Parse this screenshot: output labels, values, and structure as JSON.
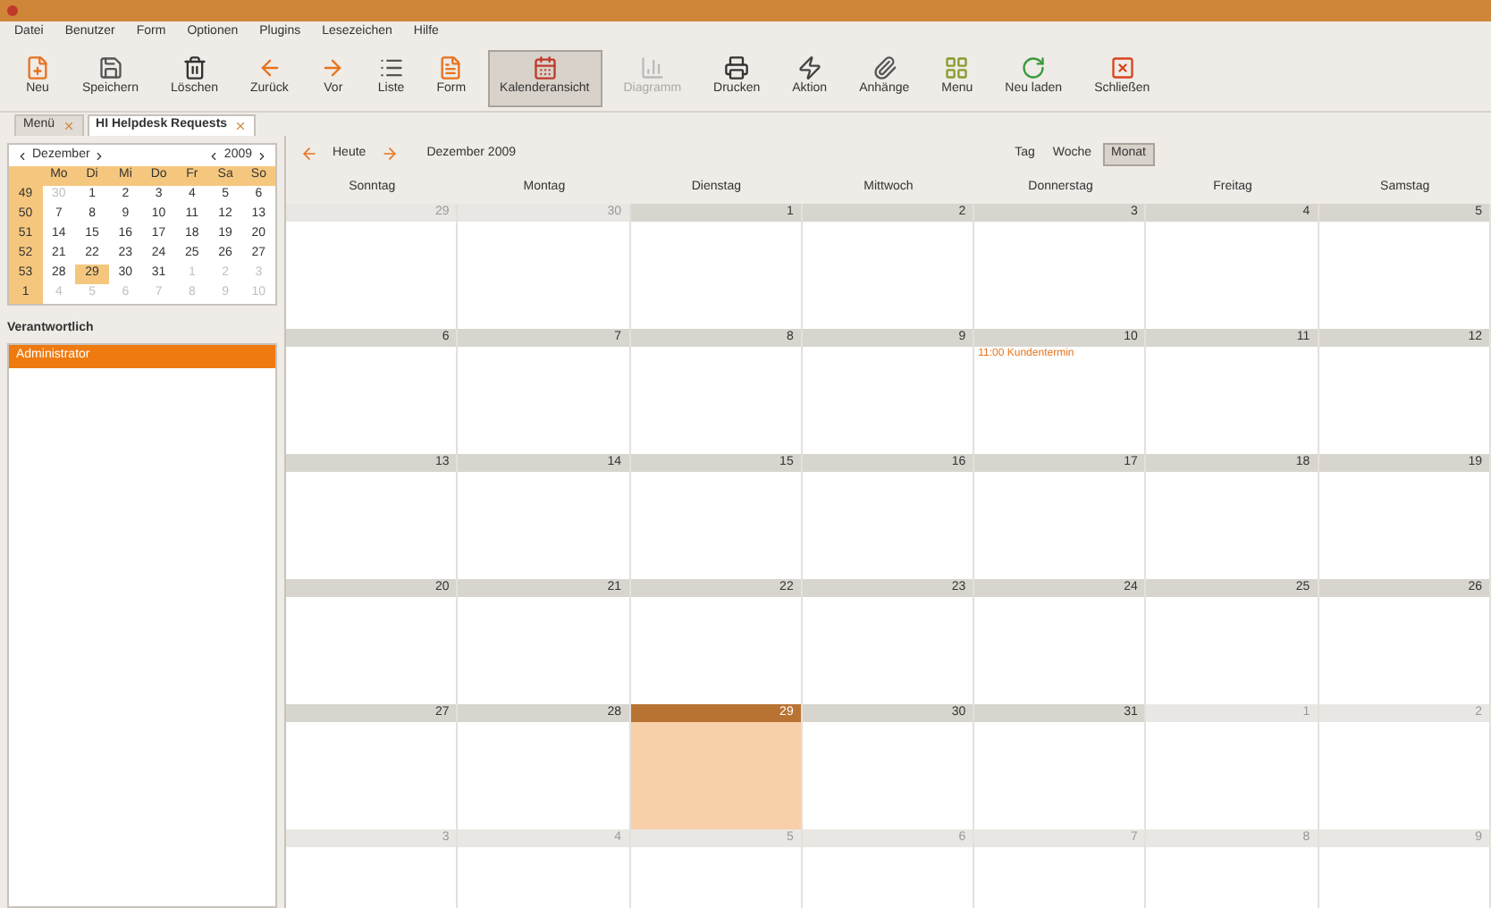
{
  "menu": [
    "Datei",
    "Benutzer",
    "Form",
    "Optionen",
    "Plugins",
    "Lesezeichen",
    "Hilfe"
  ],
  "toolbar": [
    {
      "kind": "new",
      "label": "Neu",
      "selected": false,
      "disabled": false
    },
    {
      "kind": "save",
      "label": "Speichern",
      "selected": false,
      "disabled": false
    },
    {
      "kind": "delete",
      "label": "Löschen",
      "selected": false,
      "disabled": false
    },
    {
      "kind": "back",
      "label": "Zurück",
      "selected": false,
      "disabled": false
    },
    {
      "kind": "forward",
      "label": "Vor",
      "selected": false,
      "disabled": false
    },
    {
      "kind": "list",
      "label": "Liste",
      "selected": false,
      "disabled": false
    },
    {
      "kind": "form",
      "label": "Form",
      "selected": false,
      "disabled": false
    },
    {
      "kind": "calendar",
      "label": "Kalenderansicht",
      "selected": true,
      "disabled": false
    },
    {
      "kind": "graph",
      "label": "Diagramm",
      "selected": false,
      "disabled": true
    },
    {
      "kind": "print",
      "label": "Drucken",
      "selected": false,
      "disabled": false
    },
    {
      "kind": "action",
      "label": "Aktion",
      "selected": false,
      "disabled": false
    },
    {
      "kind": "attach",
      "label": "Anhänge",
      "selected": false,
      "disabled": false
    },
    {
      "kind": "menu",
      "label": "Menu",
      "selected": false,
      "disabled": false
    },
    {
      "kind": "reload",
      "label": "Neu laden",
      "selected": false,
      "disabled": false
    },
    {
      "kind": "close",
      "label": "Schließen",
      "selected": false,
      "disabled": false
    }
  ],
  "tabs": [
    {
      "label": "Menü",
      "selected": false
    },
    {
      "label": "HI Helpdesk Requests",
      "selected": true
    }
  ],
  "mini_calendar": {
    "month": "Dezember",
    "year": "2009",
    "weekdays": [
      "Mo",
      "Di",
      "Mi",
      "Do",
      "Fr",
      "Sa",
      "So"
    ],
    "weeks": [
      {
        "week": "49",
        "days": [
          {
            "day": "30",
            "in_month": false,
            "selected": false
          },
          {
            "day": "1",
            "in_month": true,
            "selected": false
          },
          {
            "day": "2",
            "in_month": true,
            "selected": false
          },
          {
            "day": "3",
            "in_month": true,
            "selected": false
          },
          {
            "day": "4",
            "in_month": true,
            "selected": false
          },
          {
            "day": "5",
            "in_month": true,
            "selected": false
          },
          {
            "day": "6",
            "in_month": true,
            "selected": false
          }
        ]
      },
      {
        "week": "50",
        "days": [
          {
            "day": "7",
            "in_month": true,
            "selected": false
          },
          {
            "day": "8",
            "in_month": true,
            "selected": false
          },
          {
            "day": "9",
            "in_month": true,
            "selected": false
          },
          {
            "day": "10",
            "in_month": true,
            "selected": false
          },
          {
            "day": "11",
            "in_month": true,
            "selected": false
          },
          {
            "day": "12",
            "in_month": true,
            "selected": false
          },
          {
            "day": "13",
            "in_month": true,
            "selected": false
          }
        ]
      },
      {
        "week": "51",
        "days": [
          {
            "day": "14",
            "in_month": true,
            "selected": false
          },
          {
            "day": "15",
            "in_month": true,
            "selected": false
          },
          {
            "day": "16",
            "in_month": true,
            "selected": false
          },
          {
            "day": "17",
            "in_month": true,
            "selected": false
          },
          {
            "day": "18",
            "in_month": true,
            "selected": false
          },
          {
            "day": "19",
            "in_month": true,
            "selected": false
          },
          {
            "day": "20",
            "in_month": true,
            "selected": false
          }
        ]
      },
      {
        "week": "52",
        "days": [
          {
            "day": "21",
            "in_month": true,
            "selected": false
          },
          {
            "day": "22",
            "in_month": true,
            "selected": false
          },
          {
            "day": "23",
            "in_month": true,
            "selected": false
          },
          {
            "day": "24",
            "in_month": true,
            "selected": false
          },
          {
            "day": "25",
            "in_month": true,
            "selected": false
          },
          {
            "day": "26",
            "in_month": true,
            "selected": false
          },
          {
            "day": "27",
            "in_month": true,
            "selected": false
          }
        ]
      },
      {
        "week": "53",
        "days": [
          {
            "day": "28",
            "in_month": true,
            "selected": false
          },
          {
            "day": "29",
            "in_month": true,
            "selected": true
          },
          {
            "day": "30",
            "in_month": true,
            "selected": false
          },
          {
            "day": "31",
            "in_month": true,
            "selected": false
          },
          {
            "day": "1",
            "in_month": false,
            "selected": false
          },
          {
            "day": "2",
            "in_month": false,
            "selected": false
          },
          {
            "day": "3",
            "in_month": false,
            "selected": false
          }
        ]
      },
      {
        "week": "1",
        "days": [
          {
            "day": "4",
            "in_month": false,
            "selected": false
          },
          {
            "day": "5",
            "in_month": false,
            "selected": false
          },
          {
            "day": "6",
            "in_month": false,
            "selected": false
          },
          {
            "day": "7",
            "in_month": false,
            "selected": false
          },
          {
            "day": "8",
            "in_month": false,
            "selected": false
          },
          {
            "day": "9",
            "in_month": false,
            "selected": false
          },
          {
            "day": "10",
            "in_month": false,
            "selected": false
          }
        ]
      }
    ]
  },
  "filter": {
    "heading": "Verantwortlich",
    "items": [
      {
        "label": "Administrator",
        "selected": true
      }
    ]
  },
  "navigation": {
    "today": "Heute",
    "period": "Dezember 2009"
  },
  "views": [
    {
      "label": "Tag",
      "selected": false
    },
    {
      "label": "Woche",
      "selected": false
    },
    {
      "label": "Monat",
      "selected": true
    }
  ],
  "calendar": {
    "weekdays": [
      "Sonntag",
      "Montag",
      "Dienstag",
      "Mittwoch",
      "Donnerstag",
      "Freitag",
      "Samstag"
    ],
    "weeks": [
      [
        {
          "day": "29",
          "in_month": false,
          "selected": false
        },
        {
          "day": "30",
          "in_month": false,
          "selected": false
        },
        {
          "day": "1",
          "in_month": true,
          "selected": false
        },
        {
          "day": "2",
          "in_month": true,
          "selected": false
        },
        {
          "day": "3",
          "in_month": true,
          "selected": false
        },
        {
          "day": "4",
          "in_month": true,
          "selected": false
        },
        {
          "day": "5",
          "in_month": true,
          "selected": false
        }
      ],
      [
        {
          "day": "6",
          "in_month": true,
          "selected": false
        },
        {
          "day": "7",
          "in_month": true,
          "selected": false
        },
        {
          "day": "8",
          "in_month": true,
          "selected": false
        },
        {
          "day": "9",
          "in_month": true,
          "selected": false
        },
        {
          "day": "10",
          "in_month": true,
          "selected": false,
          "events": [
            "11:00 Kundentermin"
          ]
        },
        {
          "day": "11",
          "in_month": true,
          "selected": false
        },
        {
          "day": "12",
          "in_month": true,
          "selected": false
        }
      ],
      [
        {
          "day": "13",
          "in_month": true,
          "selected": false
        },
        {
          "day": "14",
          "in_month": true,
          "selected": false
        },
        {
          "day": "15",
          "in_month": true,
          "selected": false
        },
        {
          "day": "16",
          "in_month": true,
          "selected": false
        },
        {
          "day": "17",
          "in_month": true,
          "selected": false
        },
        {
          "day": "18",
          "in_month": true,
          "selected": false
        },
        {
          "day": "19",
          "in_month": true,
          "selected": false
        }
      ],
      [
        {
          "day": "20",
          "in_month": true,
          "selected": false
        },
        {
          "day": "21",
          "in_month": true,
          "selected": false
        },
        {
          "day": "22",
          "in_month": true,
          "selected": false
        },
        {
          "day": "23",
          "in_month": true,
          "selected": false
        },
        {
          "day": "24",
          "in_month": true,
          "selected": false
        },
        {
          "day": "25",
          "in_month": true,
          "selected": false
        },
        {
          "day": "26",
          "in_month": true,
          "selected": false
        }
      ],
      [
        {
          "day": "27",
          "in_month": true,
          "selected": false
        },
        {
          "day": "28",
          "in_month": true,
          "selected": false
        },
        {
          "day": "29",
          "in_month": true,
          "selected": true
        },
        {
          "day": "30",
          "in_month": true,
          "selected": false
        },
        {
          "day": "31",
          "in_month": true,
          "selected": false
        },
        {
          "day": "1",
          "in_month": false,
          "selected": false
        },
        {
          "day": "2",
          "in_month": false,
          "selected": false
        }
      ],
      [
        {
          "day": "3",
          "in_month": false,
          "selected": false
        },
        {
          "day": "4",
          "in_month": false,
          "selected": false
        },
        {
          "day": "5",
          "in_month": false,
          "selected": false
        },
        {
          "day": "6",
          "in_month": false,
          "selected": false
        },
        {
          "day": "7",
          "in_month": false,
          "selected": false
        },
        {
          "day": "8",
          "in_month": false,
          "selected": false
        },
        {
          "day": "9",
          "in_month": false,
          "selected": false
        }
      ]
    ]
  }
}
